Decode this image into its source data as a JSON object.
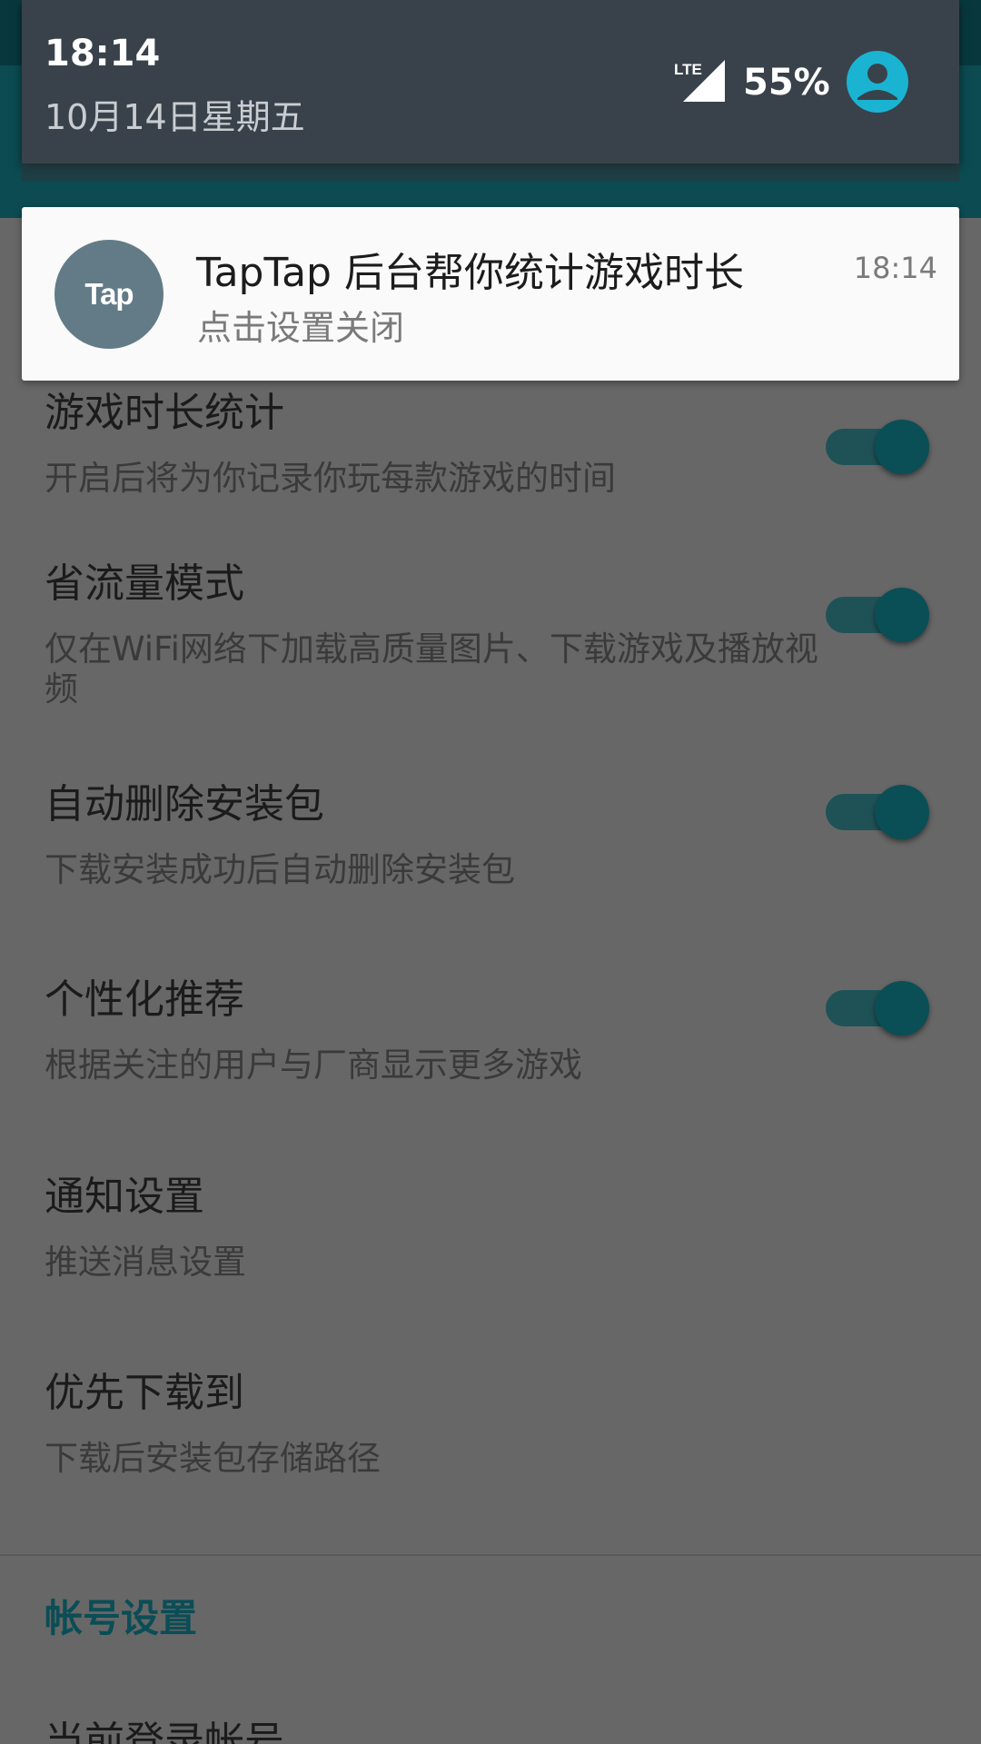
{
  "status_shade": {
    "time": "18:14",
    "date": "10月14日星期五",
    "network": "LTE",
    "battery": "55%",
    "icons": {
      "signal": "signal-lte-icon",
      "user": "user-avatar-icon"
    }
  },
  "notification": {
    "app_logo_text": "Tap",
    "title": "TapTap 后台帮你统计游戏时长",
    "subtitle": "点击设置关闭",
    "time": "18:14"
  },
  "settings": [
    {
      "title": "游戏时长统计",
      "desc": "开启后将为你记录你玩每款游戏的时间",
      "toggle_on": true
    },
    {
      "title": "省流量模式",
      "desc": "仅在WiFi网络下加载高质量图片、下载游戏及播放视频",
      "toggle_on": true
    },
    {
      "title": "自动删除安装包",
      "desc": "下载安装成功后自动删除安装包",
      "toggle_on": true
    },
    {
      "title": "个性化推荐",
      "desc": "根据关注的用户与厂商显示更多游戏",
      "toggle_on": true
    },
    {
      "title": "通知设置",
      "desc": "推送消息设置"
    },
    {
      "title": "优先下载到",
      "desc": "下载后安装包存储路径"
    }
  ],
  "account_section": {
    "header": "帐号设置",
    "first_item": "当前登录帐号"
  },
  "colors": {
    "accent_teal": "#0b4d56",
    "notification_bg": "#fafafa",
    "shade_bg": "#39424a",
    "avatar_cyan": "#1bb3d2"
  }
}
